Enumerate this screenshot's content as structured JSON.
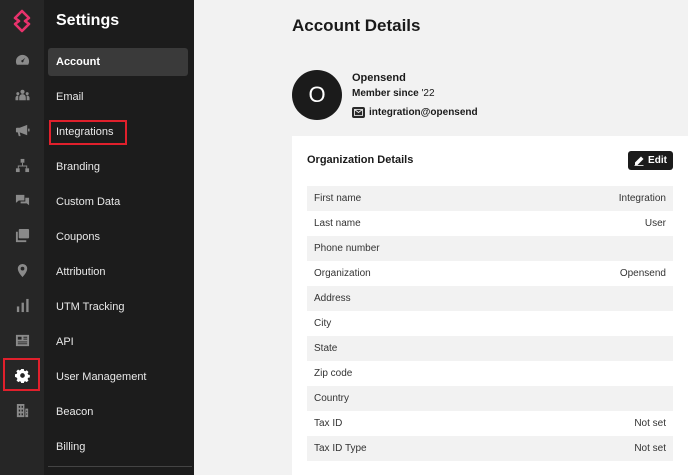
{
  "sidebar_icons": [
    "dashboard-icon",
    "audience-icon",
    "megaphone-icon",
    "hierarchy-icon",
    "chat-icon",
    "gallery-icon",
    "location-icon",
    "bar-chart-icon",
    "newspaper-icon",
    "gear-icon",
    "building-icon"
  ],
  "settings": {
    "title": "Settings",
    "items": [
      {
        "label": "Account"
      },
      {
        "label": "Email"
      },
      {
        "label": "Integrations"
      },
      {
        "label": "Branding"
      },
      {
        "label": "Custom Data"
      },
      {
        "label": "Coupons"
      },
      {
        "label": "Attribution"
      },
      {
        "label": "UTM Tracking"
      },
      {
        "label": "API"
      },
      {
        "label": "User Management"
      },
      {
        "label": "Beacon"
      },
      {
        "label": "Billing"
      }
    ]
  },
  "main": {
    "title": "Account Details",
    "profile": {
      "initial": "O",
      "name": "Opensend",
      "member_since_label": "Member since",
      "member_since_value": "'22",
      "email": "integration@opensend"
    },
    "org": {
      "title": "Organization Details",
      "edit_label": "Edit",
      "rows": [
        {
          "label": "First name",
          "value": "Integration"
        },
        {
          "label": "Last name",
          "value": "User"
        },
        {
          "label": "Phone number",
          "value": ""
        },
        {
          "label": "Organization",
          "value": "Opensend"
        },
        {
          "label": "Address",
          "value": ""
        },
        {
          "label": "City",
          "value": ""
        },
        {
          "label": "State",
          "value": ""
        },
        {
          "label": "Zip code",
          "value": ""
        },
        {
          "label": "Country",
          "value": ""
        },
        {
          "label": "Tax ID",
          "value": "Not set"
        },
        {
          "label": "Tax ID Type",
          "value": "Not set"
        }
      ]
    }
  },
  "colors": {
    "brand": "#e8326c",
    "highlight": "#e0202c"
  }
}
